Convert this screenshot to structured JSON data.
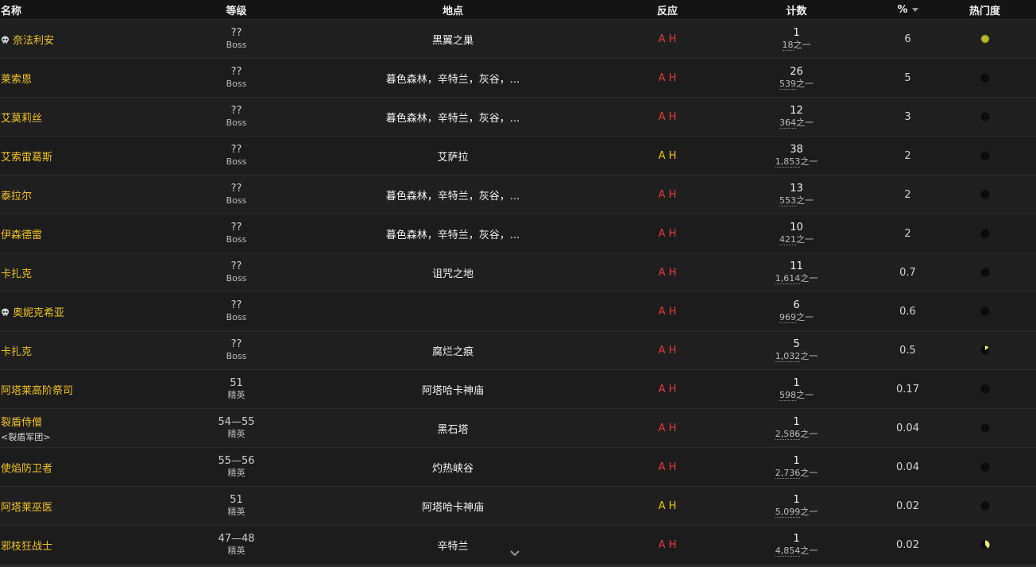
{
  "colors": {
    "name_link": "#f2c12e",
    "hostile": "#e23b3b",
    "neutral": "#f0c419",
    "popularity_high": "#b7b733",
    "popularity_base": "#0c0c0c"
  },
  "header": {
    "name": "名称",
    "level": "等级",
    "location": "地点",
    "reaction": "反应",
    "count": "计数",
    "percent": "%",
    "popularity": "热门度"
  },
  "rows": [
    {
      "skull": true,
      "name": "奈法利安",
      "tag": "",
      "level": "??",
      "level_sub": "Boss",
      "location": "黑翼之巢",
      "a": "A",
      "h": "H",
      "react_color": "hostile",
      "count": "1",
      "of": "18",
      "of_suffix": "之一",
      "percent": "6",
      "pop_icon": "popularity-full-icon",
      "pop_fill": 1.0
    },
    {
      "skull": false,
      "name": "莱索恩",
      "tag": "",
      "level": "??",
      "level_sub": "Boss",
      "location": "暮色森林，辛特兰，灰谷，...",
      "a": "A",
      "h": "H",
      "react_color": "hostile",
      "count": "26",
      "of": "539",
      "of_suffix": "之一",
      "percent": "5",
      "pop_icon": "popularity-empty-icon",
      "pop_fill": 0.0
    },
    {
      "skull": false,
      "name": "艾莫莉丝",
      "tag": "",
      "level": "??",
      "level_sub": "Boss",
      "location": "暮色森林，辛特兰，灰谷，...",
      "a": "A",
      "h": "H",
      "react_color": "hostile",
      "count": "12",
      "of": "364",
      "of_suffix": "之一",
      "percent": "3",
      "pop_icon": "popularity-empty-icon",
      "pop_fill": 0.0
    },
    {
      "skull": false,
      "name": "艾索雷葛斯",
      "tag": "",
      "level": "??",
      "level_sub": "Boss",
      "location": "艾萨拉",
      "a": "A",
      "h": "H",
      "react_color": "neutral",
      "count": "38",
      "of": "1,853",
      "of_suffix": "之一",
      "percent": "2",
      "pop_icon": "popularity-empty-icon",
      "pop_fill": 0.0
    },
    {
      "skull": false,
      "name": "泰拉尔",
      "tag": "",
      "level": "??",
      "level_sub": "Boss",
      "location": "暮色森林，辛特兰，灰谷，...",
      "a": "A",
      "h": "H",
      "react_color": "hostile",
      "count": "13",
      "of": "553",
      "of_suffix": "之一",
      "percent": "2",
      "pop_icon": "popularity-empty-icon",
      "pop_fill": 0.0
    },
    {
      "skull": false,
      "name": "伊森德雷",
      "tag": "",
      "level": "??",
      "level_sub": "Boss",
      "location": "暮色森林，辛特兰，灰谷，...",
      "a": "A",
      "h": "H",
      "react_color": "hostile",
      "count": "10",
      "of": "421",
      "of_suffix": "之一",
      "percent": "2",
      "pop_icon": "popularity-empty-icon",
      "pop_fill": 0.0
    },
    {
      "skull": false,
      "name": "卡扎克",
      "tag": "",
      "level": "??",
      "level_sub": "Boss",
      "location": "诅咒之地",
      "a": "A",
      "h": "H",
      "react_color": "hostile",
      "count": "11",
      "of": "1,614",
      "of_suffix": "之一",
      "percent": "0.7",
      "pop_icon": "popularity-empty-icon",
      "pop_fill": 0.0
    },
    {
      "skull": true,
      "name": "奥妮克希亚",
      "tag": "",
      "level": "??",
      "level_sub": "Boss",
      "location": "",
      "a": "A",
      "h": "H",
      "react_color": "hostile",
      "count": "6",
      "of": "969",
      "of_suffix": "之一",
      "percent": "0.6",
      "pop_icon": "popularity-empty-icon",
      "pop_fill": 0.0
    },
    {
      "skull": false,
      "name": "卡扎克",
      "tag": "",
      "level": "??",
      "level_sub": "Boss",
      "location": "腐烂之痕",
      "a": "A",
      "h": "H",
      "react_color": "hostile",
      "count": "5",
      "of": "1,032",
      "of_suffix": "之一",
      "percent": "0.5",
      "pop_icon": "popularity-partial-icon",
      "pop_fill": 0.15
    },
    {
      "skull": false,
      "name": "阿塔莱高阶祭司",
      "tag": "",
      "level": "51",
      "level_sub": "精英",
      "location": "阿塔哈卡神庙",
      "a": "A",
      "h": "H",
      "react_color": "hostile",
      "count": "1",
      "of": "598",
      "of_suffix": "之一",
      "percent": "0.17",
      "pop_icon": "popularity-empty-icon",
      "pop_fill": 0.0
    },
    {
      "skull": false,
      "name": "裂盾侍僧",
      "tag": "<裂盾军团>",
      "level": "54—55",
      "level_sub": "精英",
      "location": "黑石塔",
      "a": "A",
      "h": "H",
      "react_color": "hostile",
      "count": "1",
      "of": "2,586",
      "of_suffix": "之一",
      "percent": "0.04",
      "pop_icon": "popularity-empty-icon",
      "pop_fill": 0.0
    },
    {
      "skull": false,
      "name": "使焰防卫者",
      "tag": "",
      "level": "55—56",
      "level_sub": "精英",
      "location": "灼热峡谷",
      "a": "A",
      "h": "H",
      "react_color": "hostile",
      "count": "1",
      "of": "2,736",
      "of_suffix": "之一",
      "percent": "0.04",
      "pop_icon": "popularity-empty-icon",
      "pop_fill": 0.0
    },
    {
      "skull": false,
      "name": "阿塔莱巫医",
      "tag": "",
      "level": "51",
      "level_sub": "精英",
      "location": "阿塔哈卡神庙",
      "a": "A",
      "h": "H",
      "react_color": "neutral",
      "count": "1",
      "of": "5,099",
      "of_suffix": "之一",
      "percent": "0.02",
      "pop_icon": "popularity-empty-icon",
      "pop_fill": 0.0
    },
    {
      "skull": false,
      "name": "邪枝狂战士",
      "tag": "",
      "level": "47—48",
      "level_sub": "精英",
      "location": "辛特兰",
      "a": "A",
      "h": "H",
      "react_color": "hostile",
      "count": "1",
      "of": "4,854",
      "of_suffix": "之一",
      "percent": "0.02",
      "pop_icon": "popularity-partial-icon",
      "pop_fill": 0.4
    }
  ],
  "scroll_icon": "chevron-down-icon"
}
